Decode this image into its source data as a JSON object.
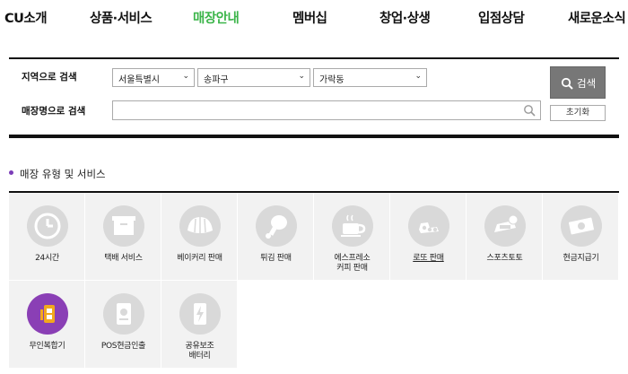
{
  "nav": {
    "items": [
      {
        "label": "CU소개",
        "active": false
      },
      {
        "label": "상품·서비스",
        "active": false
      },
      {
        "label": "매장안내",
        "active": true
      },
      {
        "label": "멤버십",
        "active": false
      },
      {
        "label": "창업·상생",
        "active": false
      },
      {
        "label": "입점상담",
        "active": false
      },
      {
        "label": "새로운소식",
        "active": false
      }
    ]
  },
  "search": {
    "region_label": "지역으로 검색",
    "name_label": "매장명으로 검색",
    "city": "서울특별시",
    "district": "송파구",
    "dong": "가락동",
    "name_value": "",
    "search_button": "검색",
    "reset_button": "초기화"
  },
  "section": {
    "title": "매장 유형 및 서비스"
  },
  "services": [
    {
      "label": "24시간",
      "icon": "clock-icon"
    },
    {
      "label": "택배 서비스",
      "icon": "parcel-box-icon"
    },
    {
      "label": "베이커리 판매",
      "icon": "croissant-icon"
    },
    {
      "label": "튀김 판매",
      "icon": "chicken-leg-icon"
    },
    {
      "label": "에스프레소\n커피 판매",
      "icon": "coffee-cup-icon"
    },
    {
      "label": "로또 판매",
      "icon": "lotto-icon"
    },
    {
      "label": "스포츠토토",
      "icon": "toto-ball-icon"
    },
    {
      "label": "현금지급기",
      "icon": "cash-icon"
    },
    {
      "label": "무인복합기",
      "icon": "kiosk-icon"
    },
    {
      "label": "POS현금인출",
      "icon": "pos-cash-icon"
    },
    {
      "label": "공유보조\n배터리",
      "icon": "battery-icon"
    }
  ],
  "colors": {
    "active_nav": "#3cb54a",
    "bullet": "#7b3db8",
    "kiosk_circle": "#8a3fb5",
    "kiosk_glyph": "#f2a81d",
    "icon_circle": "#d9d9d9",
    "cell_bg": "#f2f2f2",
    "search_button": "#777777"
  }
}
